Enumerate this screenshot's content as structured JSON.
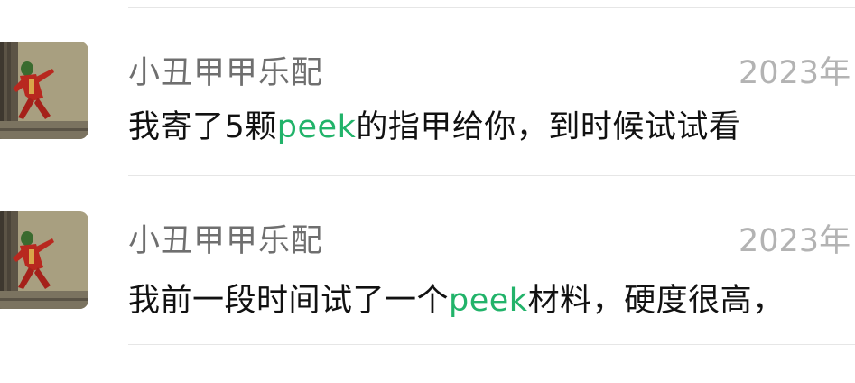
{
  "chats": [
    {
      "name": "小丑甲甲乐配",
      "time": "2023年",
      "message_before": "我寄了5颗",
      "message_highlight": "peek",
      "message_after": "的指甲给你，到时候试试看",
      "avatar_icon": "joker-stairs-avatar"
    },
    {
      "name": "小丑甲甲乐配",
      "time": "2023年",
      "message_before": "我前一段时间试了一个",
      "message_highlight": "peek",
      "message_after": "材料，硬度很高，",
      "avatar_icon": "joker-stairs-avatar"
    }
  ],
  "colors": {
    "highlight": "#22b36a",
    "name": "#6f6f6f",
    "time": "#b3b3b3",
    "message": "#111111",
    "divider": "#e6e6e6"
  }
}
